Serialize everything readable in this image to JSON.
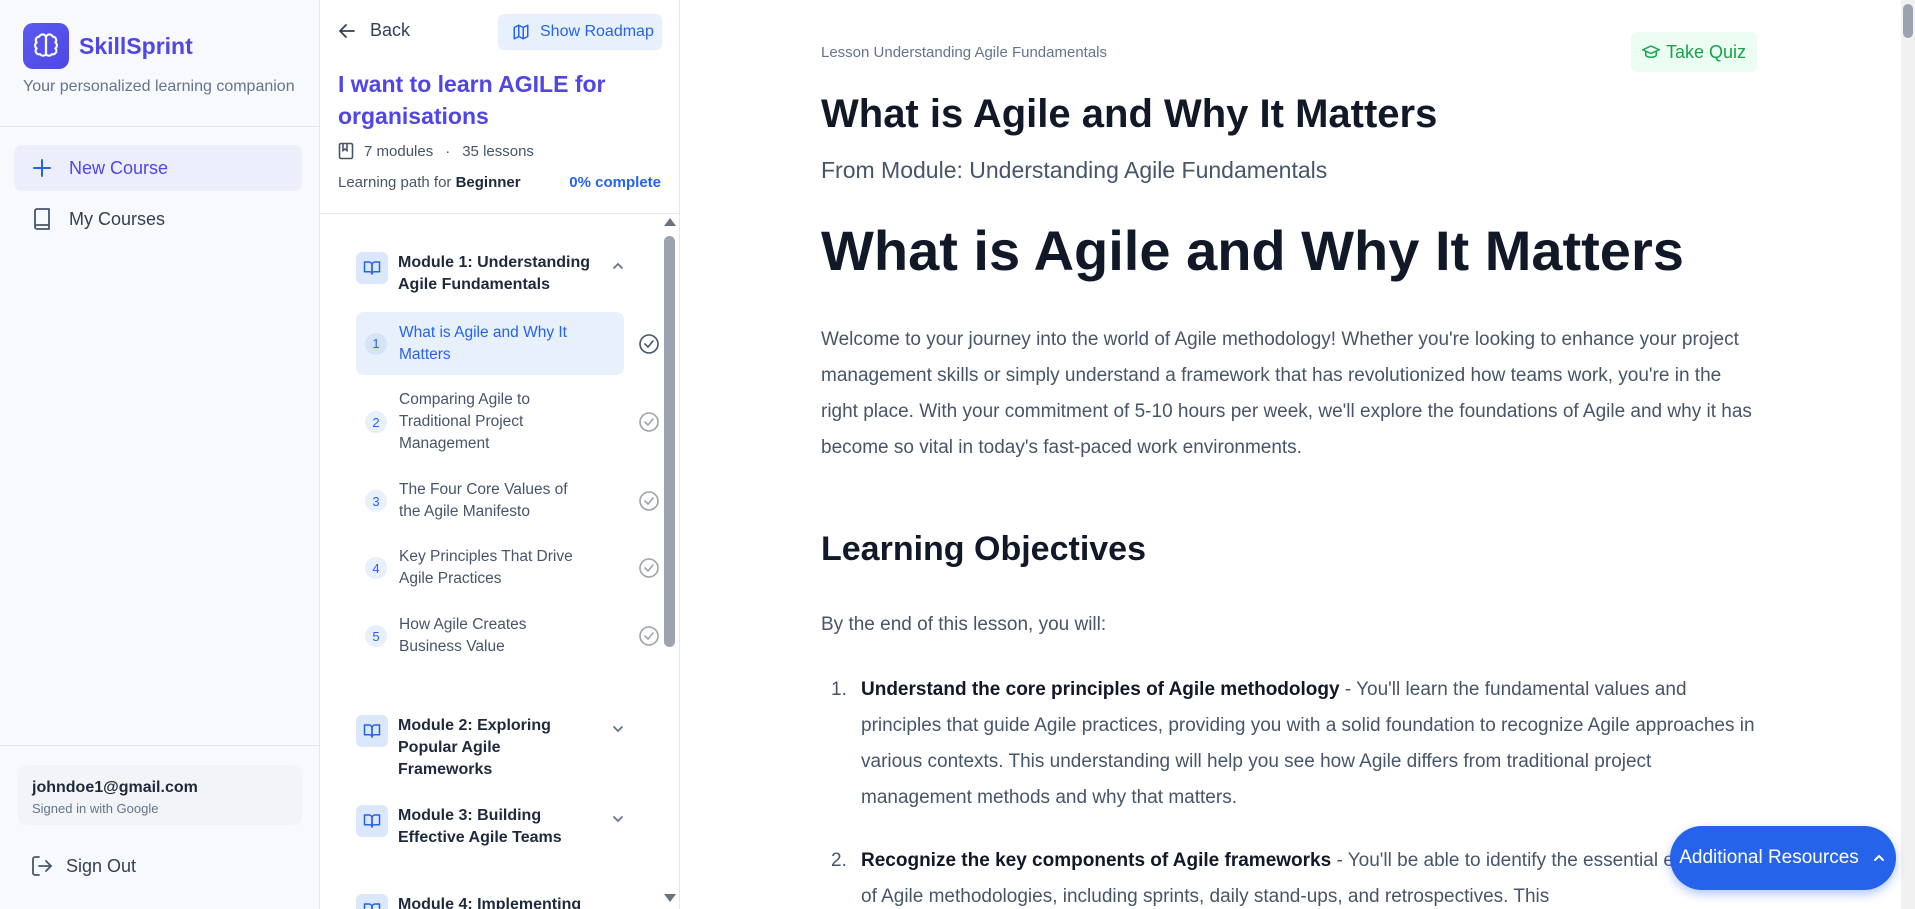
{
  "app": {
    "name": "SkillSprint",
    "tagline": "Your personalized learning companion",
    "brand_color": "#4f46e5"
  },
  "nav": {
    "new_course": "New Course",
    "my_courses": "My Courses"
  },
  "user": {
    "email": "johndoe1@gmail.com",
    "signin_method": "Signed in with Google",
    "sign_out": "Sign Out"
  },
  "course": {
    "back": "Back",
    "show_roadmap": "Show Roadmap",
    "title": "I want to learn AGILE for organisations",
    "modules_count": "7 modules",
    "lessons_count": "35 lessons",
    "learning_path_label": "Learning path for",
    "level": "Beginner",
    "progress": "0% complete",
    "modules": [
      {
        "title": "Module 1: Understanding Agile Fundamentals",
        "expanded": true,
        "lessons": [
          {
            "num": "1",
            "title": "What is Agile and Why It Matters",
            "active": true
          },
          {
            "num": "2",
            "title": "Comparing Agile to Traditional Project Management"
          },
          {
            "num": "3",
            "title": "The Four Core Values of the Agile Manifesto"
          },
          {
            "num": "4",
            "title": "Key Principles That Drive Agile Practices"
          },
          {
            "num": "5",
            "title": "How Agile Creates Business Value"
          }
        ]
      },
      {
        "title": "Module 2: Exploring Popular Agile Frameworks",
        "expanded": false
      },
      {
        "title": "Module 3: Building Effective Agile Teams",
        "expanded": false
      },
      {
        "title": "Module 4: Implementing",
        "expanded": false
      }
    ]
  },
  "lesson": {
    "crumb": "Lesson Understanding Agile Fundamentals",
    "take_quiz": "Take Quiz",
    "title": "What is Agile and Why It Matters",
    "from_module": "From Module: Understanding Agile Fundamentals",
    "heading": "What is Agile and Why It Matters",
    "intro": "Welcome to your journey into the world of Agile methodology! Whether you're looking to enhance your project management skills or simply understand a framework that has revolutionized how teams work, you're in the right place. With your commitment of 5-10 hours per week, we'll explore the foundations of Agile and why it has become so vital in today's fast-paced work environments.",
    "objectives_heading": "Learning Objectives",
    "objectives_lead": "By the end of this lesson, you will:",
    "objectives": [
      {
        "num": "1.",
        "bold": "Understand the core principles of Agile methodology",
        "text": " - You'll learn the fundamental values and principles that guide Agile practices, providing you with a solid foundation to recognize Agile approaches in various contexts. This understanding will help you see how Agile differs from traditional project management methods and why that matters."
      },
      {
        "num": "2.",
        "bold": "Recognize the key components of Agile frameworks",
        "text": " - You'll be able to identify the essential elements of Agile methodologies, including sprints, daily stand-ups, and retrospectives. This"
      }
    ],
    "additional_resources": "Additional Resources"
  }
}
